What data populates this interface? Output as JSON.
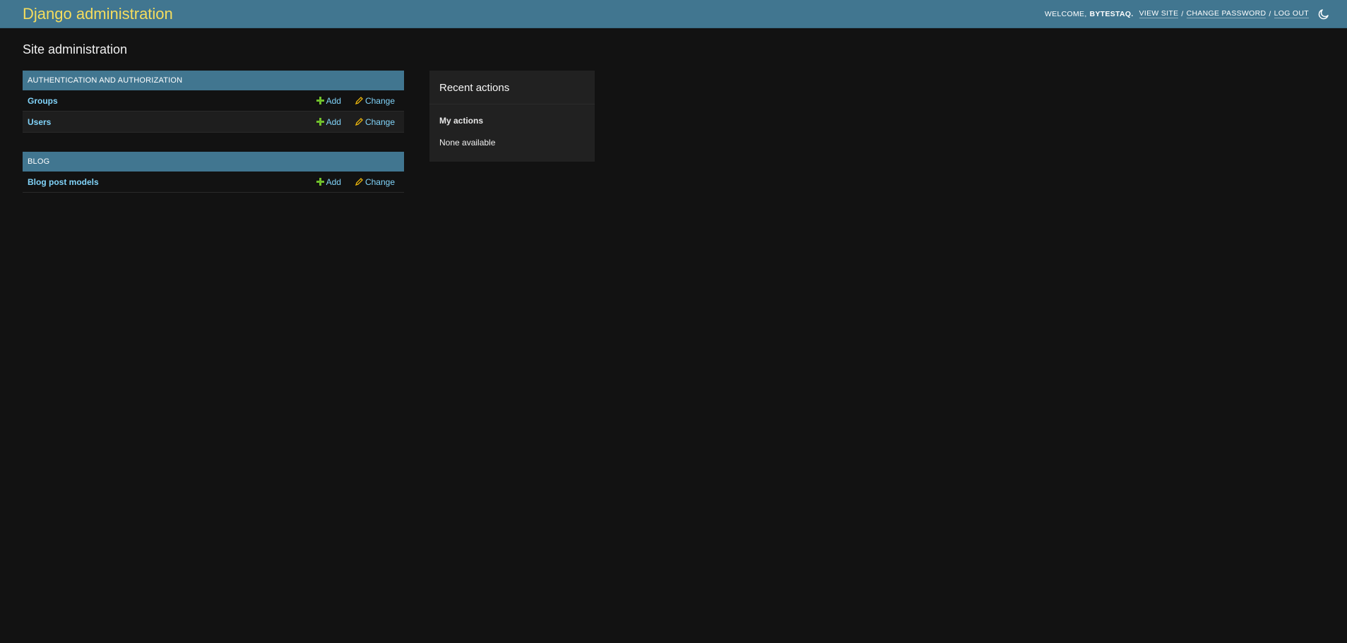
{
  "header": {
    "brand": "Django administration",
    "welcome": "Welcome,",
    "username": "BYTESTAQ.",
    "links": {
      "view_site": "View site",
      "change_password": "Change password",
      "log_out": "Log out"
    },
    "separator": "/"
  },
  "page": {
    "title": "Site administration"
  },
  "apps": [
    {
      "caption": "Authentication and Authorization",
      "models": [
        {
          "name": "Groups",
          "add": "Add",
          "change": "Change"
        },
        {
          "name": "Users",
          "add": "Add",
          "change": "Change"
        }
      ]
    },
    {
      "caption": "Blog",
      "models": [
        {
          "name": "Blog post models",
          "add": "Add",
          "change": "Change"
        }
      ]
    }
  ],
  "recent_actions": {
    "title": "Recent actions",
    "my_actions_title": "My actions",
    "empty_text": "None available"
  },
  "colors": {
    "header_bg": "#417690",
    "brand": "#f5dd5d",
    "link": "#81d4fa",
    "add_icon": "#70bf2b",
    "change_icon": "#efb80b",
    "background": "#121212"
  },
  "icons": {
    "theme_toggle": "moon-icon",
    "add": "plus-icon",
    "change": "pencil-icon"
  }
}
